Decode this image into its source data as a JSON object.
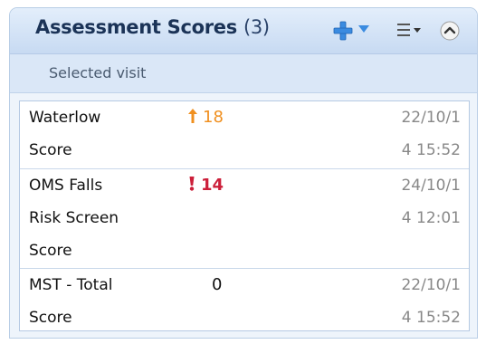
{
  "panel": {
    "title": "Assessment Scores",
    "count": "(3)",
    "subheader": "Selected visit"
  },
  "colors": {
    "header_text": "#1b3357",
    "accent_blue": "#3b8be0",
    "warning_orange": "#f09020",
    "alert_red": "#cc1f3a",
    "date_gray": "#888888"
  },
  "icons": {
    "add": "plus-icon",
    "dropdown": "chevron-down-icon",
    "menu": "menu-icon",
    "collapse": "collapse-up-icon",
    "row1": "up-arrow-icon",
    "row2": "exclamation-icon"
  },
  "rows": [
    {
      "name_lines": [
        "Waterlow",
        "Score"
      ],
      "value": "18",
      "date_lines": [
        "22/10/1",
        "4 15:52"
      ]
    },
    {
      "name_lines": [
        "OMS Falls",
        "Risk Screen",
        "Score"
      ],
      "value": "14",
      "date_lines": [
        "24/10/1",
        "4 12:01"
      ]
    },
    {
      "name_lines": [
        "MST - Total",
        "Score"
      ],
      "value": "0",
      "date_lines": [
        "22/10/1",
        "4 15:52"
      ]
    }
  ]
}
